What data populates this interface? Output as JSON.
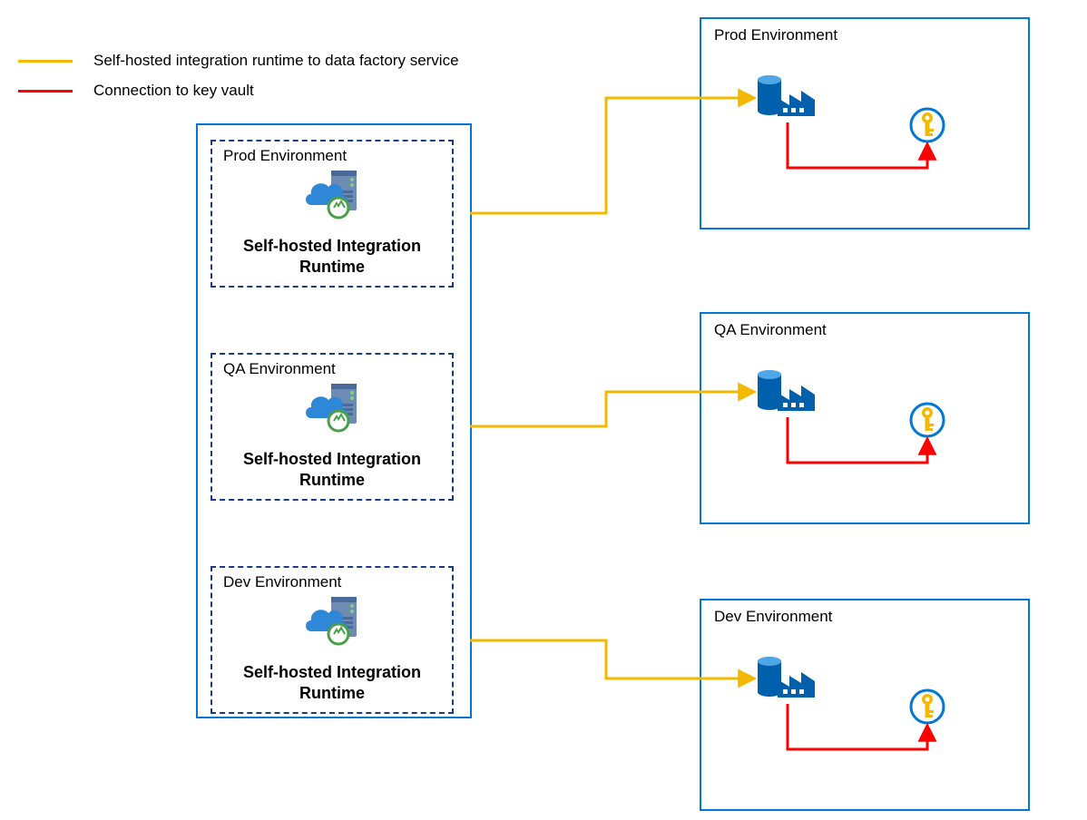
{
  "legend": {
    "yellow_label": "Self-hosted integration runtime to data factory service",
    "red_label": "Connection to key vault",
    "yellow_color": "#f2b900",
    "red_color": "#ff0000"
  },
  "left": {
    "prod": {
      "title": "Prod Environment",
      "label": "Self-hosted Integration Runtime"
    },
    "qa": {
      "title": "QA Environment",
      "label": "Self-hosted Integration Runtime"
    },
    "dev": {
      "title": "Dev Environment",
      "label": "Self-hosted Integration Runtime"
    }
  },
  "right": {
    "prod": {
      "title": "Prod Environment"
    },
    "qa": {
      "title": "QA Environment"
    },
    "dev": {
      "title": "Dev Environment"
    }
  },
  "colors": {
    "blue_border": "#0078d4",
    "factory_blue": "#0060ac",
    "key_gold": "#f2b900"
  }
}
